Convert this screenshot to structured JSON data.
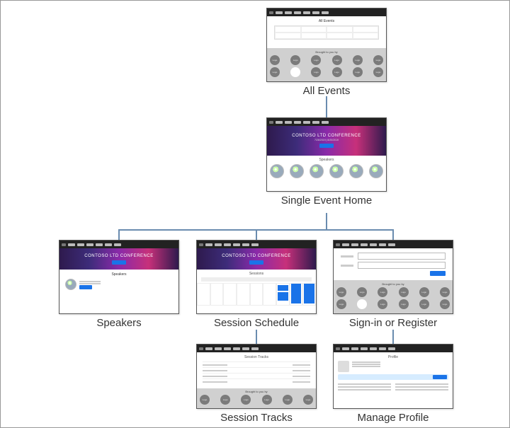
{
  "diagram": {
    "nodes": {
      "all_events": {
        "caption": "All Events"
      },
      "single_event": {
        "caption": "Single Event Home"
      },
      "speakers": {
        "caption": "Speakers"
      },
      "schedule": {
        "caption": "Session Schedule"
      },
      "signin": {
        "caption": "Sign-in or Register"
      },
      "tracks": {
        "caption": "Session Tracks"
      },
      "profile": {
        "caption": "Manage Profile"
      }
    }
  },
  "thumbnails": {
    "hero_title": "CONTOSO LTD CONFERENCE",
    "hero_subtitle": "7/26/2019 | 8/20/2019",
    "speakers_label": "Speakers",
    "sessions_label": "Sessions",
    "all_events_label": "All Events",
    "session_tracks_label": "Session Tracks",
    "profile_label": "Profile",
    "sponsors_label": "Brought to you by",
    "sponsor_logo_text": "Logo"
  }
}
